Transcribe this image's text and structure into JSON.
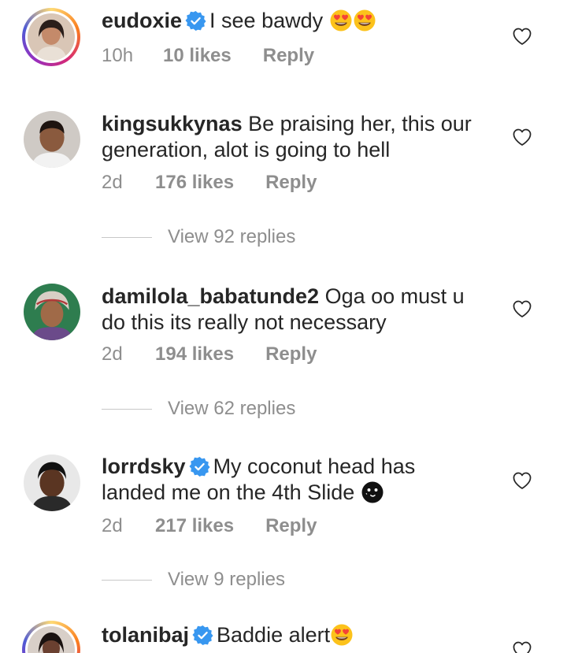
{
  "comments": [
    {
      "username": "eudoxie",
      "verified": true,
      "text": "I see bawdy",
      "emoji": [
        "heart-eyes",
        "heart-eyes"
      ],
      "time": "10h",
      "likes": "10 likes",
      "reply": "Reply"
    },
    {
      "username": "kingsukkynas",
      "verified": false,
      "text": "Be praising her, this our generation, alot is going to hell",
      "time": "2d",
      "likes": "176 likes",
      "reply": "Reply",
      "view_replies": "View 92 replies"
    },
    {
      "username": "damilola_babatunde2",
      "verified": false,
      "text": "Oga oo must u do this its really not necessary",
      "time": "2d",
      "likes": "194 likes",
      "reply": "Reply",
      "view_replies": "View 62 replies"
    },
    {
      "username": "lorrdsky",
      "verified": true,
      "text": "My coconut head has landed me on the 4th Slide",
      "emoji": [
        "dark-moon-face"
      ],
      "time": "2d",
      "likes": "217 likes",
      "reply": "Reply",
      "view_replies": "View 9 replies"
    },
    {
      "username": "tolanibaj",
      "verified": true,
      "text": "Baddie alert",
      "emoji": [
        "heart-eyes"
      ]
    }
  ],
  "colors": {
    "text": "#262626",
    "meta": "#8e8e8e",
    "verified_blue": "#3897f0",
    "story_ring": [
      "#feda75",
      "#fa7e1e",
      "#d62976",
      "#962fbf",
      "#4f5bd5"
    ]
  }
}
